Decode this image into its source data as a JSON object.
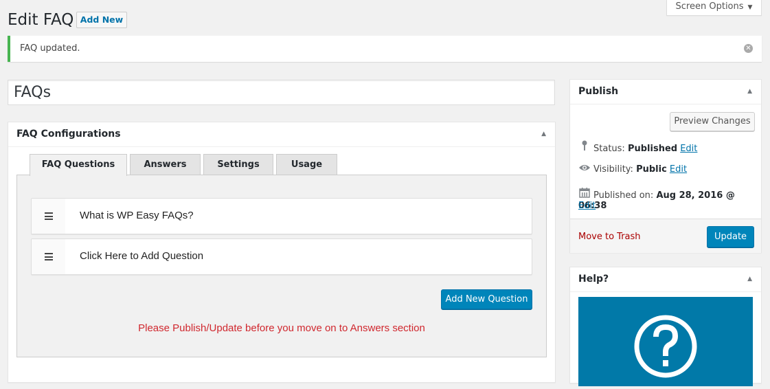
{
  "header": {
    "screen_options_label": "Screen Options",
    "page_title": "Edit FAQ",
    "add_new_label": "Add New"
  },
  "notice": {
    "message": "FAQ updated.",
    "status_color": "#46b450"
  },
  "post": {
    "title": "FAQs"
  },
  "faq_config": {
    "title": "FAQ Configurations",
    "tabs": [
      {
        "label": "FAQ Questions",
        "active": true
      },
      {
        "label": "Answers",
        "active": false
      },
      {
        "label": "Settings",
        "active": false
      },
      {
        "label": "Usage",
        "active": false
      }
    ],
    "questions": [
      {
        "text": "What is WP Easy FAQs?"
      },
      {
        "text": "Click Here to Add Question"
      }
    ],
    "add_question_label": "Add New Question",
    "warning": "Please Publish/Update before you move on to Answers section",
    "warning_color": "#d0272e"
  },
  "publish": {
    "title": "Publish",
    "preview_label": "Preview Changes",
    "status_label": "Status:",
    "status_value": "Published",
    "visibility_label": "Visibility:",
    "visibility_value": "Public",
    "published_on_label": "Published on:",
    "published_on_value": "Aug 28, 2016 @ 06:38",
    "edit_label": "Edit",
    "trash_label": "Move to Trash",
    "update_label": "Update",
    "accent_color": "#0085ba"
  },
  "help": {
    "title": "Help?"
  },
  "icons": {
    "toggle": "▲",
    "dropdown": "▼",
    "dismiss": "✕"
  }
}
